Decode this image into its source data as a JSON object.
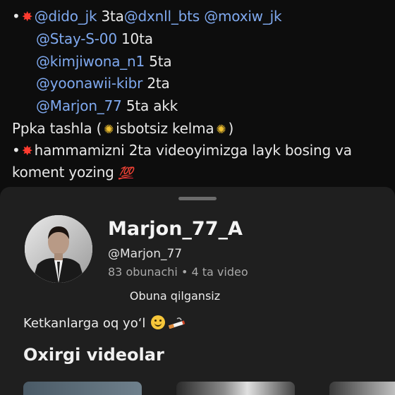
{
  "comment": {
    "line1": {
      "mentions": [
        "@dido_jk",
        "@dxnll_bts",
        "@moxiw_jk"
      ],
      "text_a": " 3ta",
      "text_b": " "
    },
    "line2": {
      "mention": "@Stay-S-00",
      "text": " 10ta"
    },
    "line3": {
      "mention": "@kimjiwona_n1",
      "text": " 5ta"
    },
    "line4": {
      "mention": "@yoonawii-kibr",
      "text": " 2ta"
    },
    "line5": {
      "mention": "@Marjon_77",
      "text": " 5ta akk"
    },
    "line6": {
      "text_a": "Ppka tashla (",
      "text_b": "isbotsiz kelma",
      "text_c": ")"
    },
    "line7": {
      "text": "hammamizni 2ta videoyimizga layk bosing va"
    },
    "line8": {
      "text": "koment yozing "
    },
    "hundred_emoji": "💯"
  },
  "profile": {
    "display_name": "Marjon_77_A",
    "handle": "@Marjon_77",
    "stats": "83 obunachi • 4 ta video",
    "subscribed_label": "Obuna qilgansiz",
    "bio": "Ketkanlarga oq yo‘l ",
    "section_title": "Oxirgi videolar"
  },
  "colors": {
    "mention": "#7fa9ef",
    "sheet_background": "#1f1f1f",
    "page_background": "#0d0d0d"
  },
  "icons": [
    "collision-emoji-icon",
    "dizzy-emoji-icon",
    "hundred-points-emoji-icon",
    "smiling-face-emoji-icon",
    "cigarette-emoji-icon"
  ]
}
